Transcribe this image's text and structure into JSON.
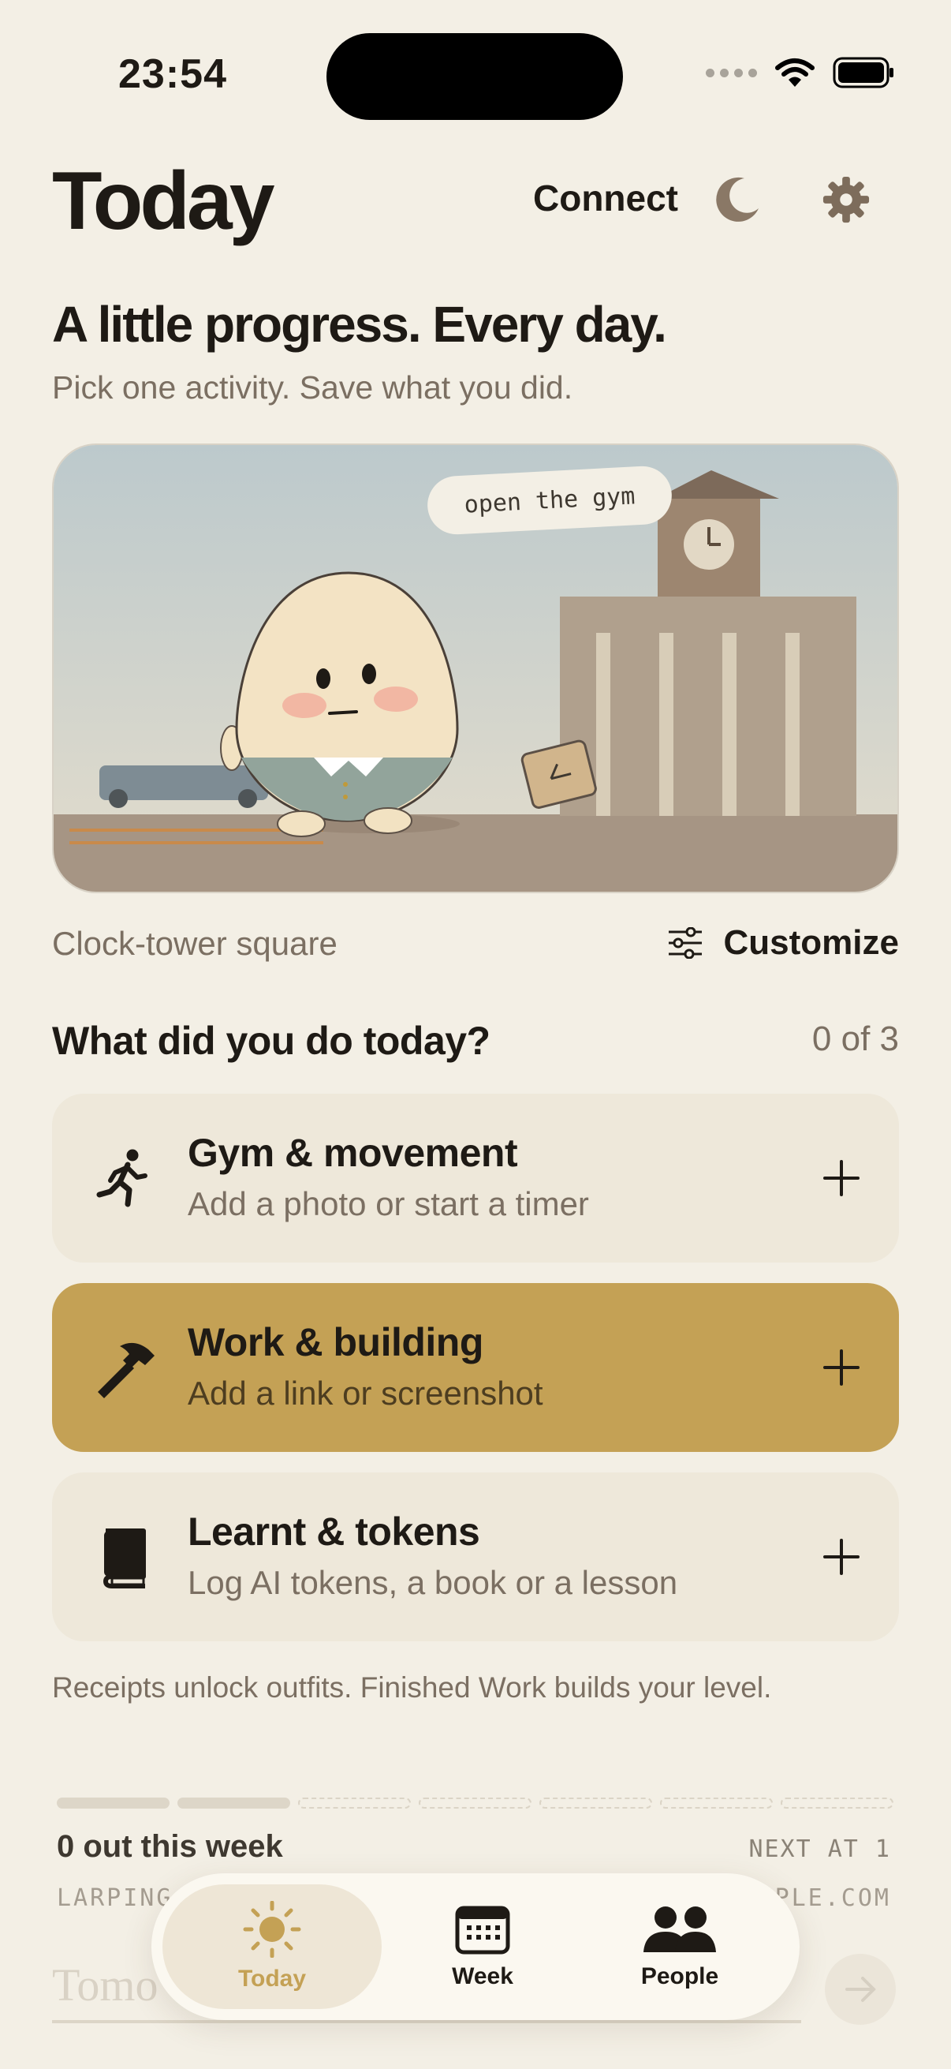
{
  "status_bar": {
    "time": "23:54"
  },
  "header": {
    "title": "Today",
    "connect_label": "Connect",
    "moon_icon": "moon-icon",
    "gear_icon": "gear-icon"
  },
  "intro": {
    "headline": "A little progress. Every day.",
    "subline": "Pick one activity. Save what you did."
  },
  "scene": {
    "speech": "open the gym",
    "place": "Clock-tower square",
    "customize_label": "Customize"
  },
  "activities": {
    "question": "What did you do today?",
    "count": "0 of 3",
    "items": [
      {
        "title": "Gym & movement",
        "subtitle": "Add a photo or start a timer",
        "icon": "running-icon",
        "selected": false
      },
      {
        "title": "Work & building",
        "subtitle": "Add a link or screenshot",
        "icon": "hammer-icon",
        "selected": true
      },
      {
        "title": "Learnt & tokens",
        "subtitle": "Log AI tokens, a book or a lesson",
        "icon": "book-icon",
        "selected": false
      }
    ],
    "note": "Receipts unlock outfits. Finished Work builds your level."
  },
  "week_progress": {
    "filled_segments": 2,
    "total_segments": 7,
    "out_label": "0 out this week",
    "next_label": "NEXT AT 1",
    "larping_left": "LARPING",
    "larping_right": "PLE.COM"
  },
  "tomorrow_placeholder": "Tomo",
  "tabbar": {
    "tabs": [
      {
        "label": "Today",
        "icon": "sun-icon",
        "active": true
      },
      {
        "label": "Week",
        "icon": "calendar-icon",
        "active": false
      },
      {
        "label": "People",
        "icon": "people-icon",
        "active": false
      }
    ]
  },
  "colors": {
    "background": "#f3efe5",
    "accent": "#c4a155",
    "card": "#eee8da",
    "muted_text": "#7b6f62"
  }
}
